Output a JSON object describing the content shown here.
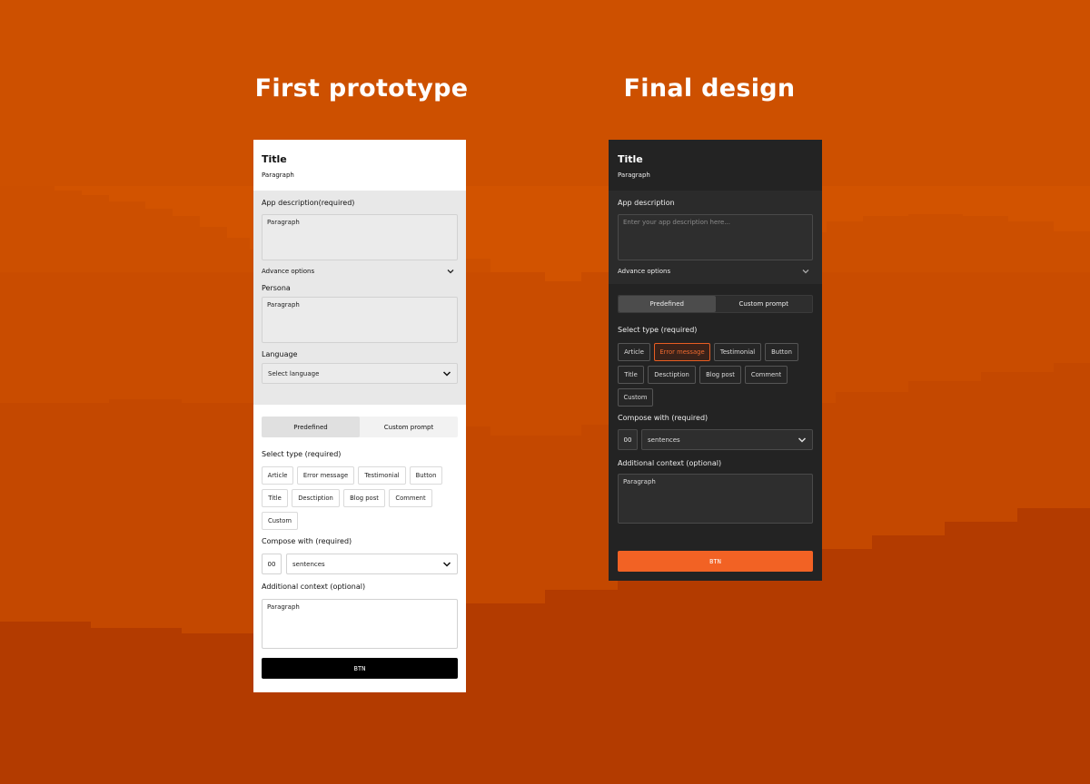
{
  "headings": {
    "left": "First prototype",
    "right": "Final design"
  },
  "colors": {
    "background": "#b33b00",
    "accent": "#f26224",
    "dark_panel": "#232323"
  },
  "prototype": {
    "title": "Title",
    "subtitle": "Paragraph",
    "app_description_label": "App description(required)",
    "app_description_value": "Paragraph",
    "advance_options_label": "Advance options",
    "persona_label": "Persona",
    "persona_value": "Paragraph",
    "language_label": "Language",
    "language_select": "Select language",
    "tabs": [
      "Predefined",
      "Custom prompt"
    ],
    "select_type_label": "Select type (required)",
    "types": [
      "Article",
      "Error message",
      "Testimonial",
      "Button",
      "Title",
      "Desctiption",
      "Blog post",
      "Comment",
      "Custom"
    ],
    "compose_label": "Compose with (required)",
    "compose_number": "00",
    "compose_unit": "sentences",
    "context_label": "Additional context (optional)",
    "context_value": "Paragraph",
    "button_label": "BTN"
  },
  "final": {
    "title": "Title",
    "subtitle": "Paragraph",
    "app_description_label": "App description",
    "app_description_placeholder": "Enter your app description here...",
    "advance_options_label": "Advance options",
    "tabs": [
      "Predefined",
      "Custom prompt"
    ],
    "select_type_label": "Select type (required)",
    "types": [
      "Article",
      "Error message",
      "Testimonial",
      "Button",
      "Title",
      "Desctiption",
      "Blog post",
      "Comment",
      "Custom"
    ],
    "selected_type": "Error message",
    "compose_label": "Compose with (required)",
    "compose_number": "00",
    "compose_unit": "sentences",
    "context_label": "Additional context (optional)",
    "context_value": "Paragraph",
    "button_label": "BTN"
  }
}
